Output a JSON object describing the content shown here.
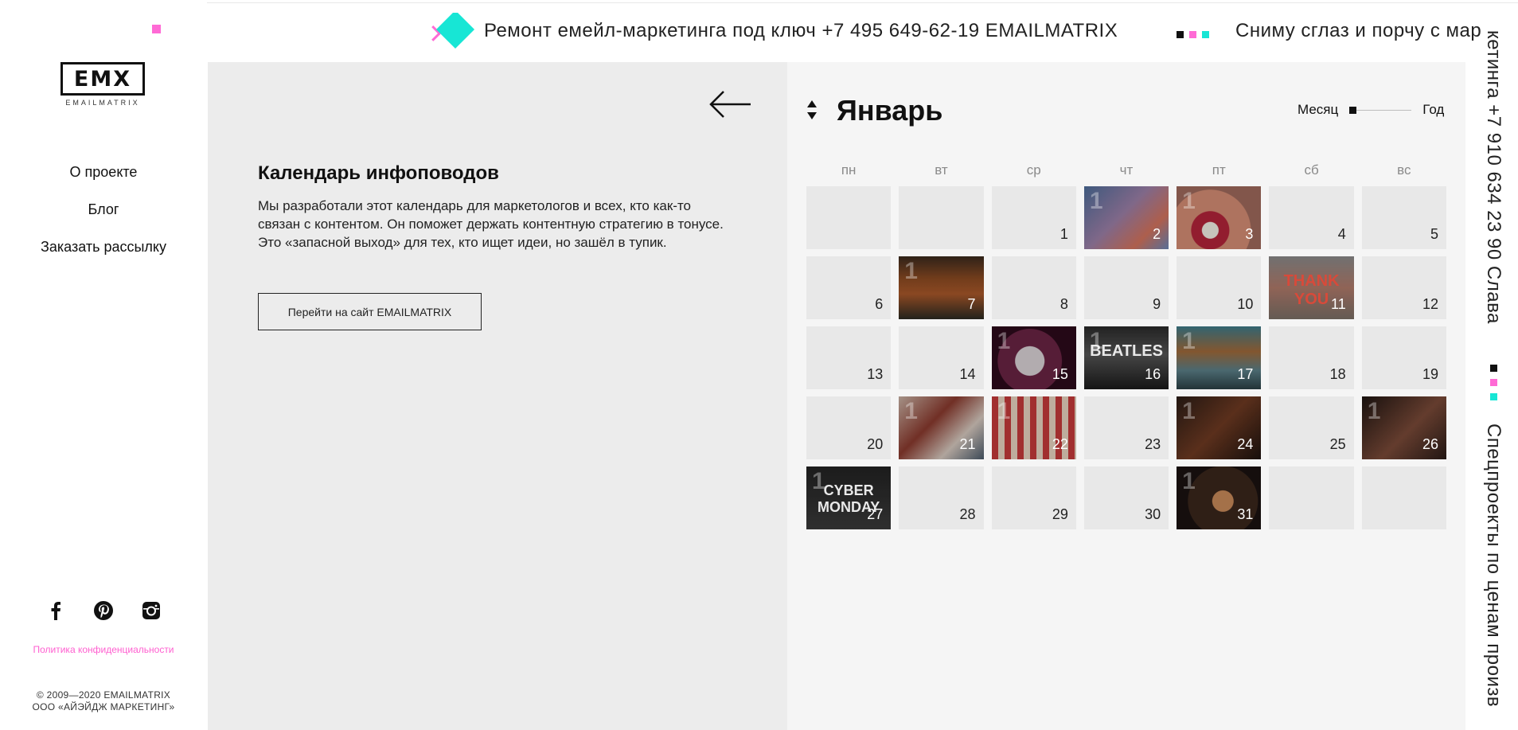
{
  "sidebar": {
    "logo_mark": "EMX",
    "logo_name": "EMAILMATRIX",
    "nav": [
      "О проекте",
      "Блог",
      "Заказать рассылку"
    ],
    "social": [
      "facebook-icon",
      "pinterest-icon",
      "instagram-icon"
    ],
    "policy": "Политика конфиденциальности",
    "copyright_line1": "© 2009—2020 EMAILMATRIX",
    "copyright_line2": "ООО «АЙЭЙДЖ МАРКЕТИНГ»"
  },
  "marquee": {
    "text1": "Ремонт емейл-маркетинга под ключ +7 495 649-62-19 EMAILMATRIX",
    "text2": "Сниму сглаз и порчу с мар",
    "vertical_text1": "кетинга +7 910 634 23 90 Слава",
    "vertical_text2": "Спецпроекты по ценам произв"
  },
  "intro": {
    "title": "Календарь инфоповодов",
    "description": "Мы разработали этот календарь для маркетологов и всех, кто как-то связан с контентом. Он поможет держать контентную стратегию в тонусе. Это «запасной выход» для тех, кто ищет идеи, но зашёл в тупик.",
    "button": "Перейти на сайт EMAILMATRIX"
  },
  "calendar": {
    "month": "Январь",
    "view_month": "Месяц",
    "view_year": "Год",
    "weekdays": [
      "пн",
      "вт",
      "ср",
      "чт",
      "пт",
      "сб",
      "вс"
    ],
    "days": [
      {
        "day": "",
        "img": false
      },
      {
        "day": "",
        "img": false
      },
      {
        "day": "1",
        "img": false
      },
      {
        "day": "2",
        "img": true,
        "badge": "1",
        "bg": "linear-gradient(135deg,#4d6d9a 0%,#9c7fa7 45%,#d4745e 75%,#6c87b8 100%)"
      },
      {
        "day": "3",
        "img": true,
        "badge": "1",
        "bg": "radial-gradient(circle at 40% 70%,#f2efe6 0 12%,#b2243a 13% 28%,#d58d74 29% 60%,#9f6a5c 61%)"
      },
      {
        "day": "4",
        "img": false
      },
      {
        "day": "5",
        "img": false
      },
      {
        "day": "6",
        "img": false
      },
      {
        "day": "7",
        "img": true,
        "badge": "1",
        "bg": "linear-gradient(180deg,#3a2a1e 0%,#8b4a22 35%,#a9582a 60%,#2a2a22 100%)"
      },
      {
        "day": "8",
        "img": false
      },
      {
        "day": "9",
        "img": false
      },
      {
        "day": "10",
        "img": false
      },
      {
        "day": "11",
        "img": true,
        "badge": "",
        "caption": "THANK YOU",
        "bg": "linear-gradient(180deg,#8a8a8a 0%,#b07a6a 50%,#7a6f66 100%)"
      },
      {
        "day": "12",
        "img": false
      },
      {
        "day": "13",
        "img": false
      },
      {
        "day": "14",
        "img": false
      },
      {
        "day": "15",
        "img": true,
        "badge": "1",
        "bg": "radial-gradient(circle at 45% 55%,#d9d2d6 0 25%,#6a2444 26% 55%,#2d0a1c 56%)"
      },
      {
        "day": "16",
        "img": true,
        "badge": "1",
        "caption": "BEATLES",
        "bg": "linear-gradient(180deg,#2a2a2a 0%,#555 45%,#1a1a1a 100%)"
      },
      {
        "day": "17",
        "img": true,
        "badge": "1",
        "bg": "linear-gradient(180deg,#3e7b8a 0%,#a06a3a 40%,#5b7f88 70%,#2b3f44 100%)"
      },
      {
        "day": "18",
        "img": false
      },
      {
        "day": "19",
        "img": false
      },
      {
        "day": "20",
        "img": false
      },
      {
        "day": "21",
        "img": true,
        "badge": "1",
        "bg": "linear-gradient(135deg,#c9b2a5 0%,#8a3a2e 40%,#d7c9bf 70%,#4a5a6a 100%)"
      },
      {
        "day": "22",
        "img": true,
        "badge": "1",
        "bg": "repeating-linear-gradient(90deg,#c53a3a 0 8px,#e8d3c0 8px 16px)"
      },
      {
        "day": "23",
        "img": false
      },
      {
        "day": "24",
        "img": true,
        "badge": "1",
        "bg": "linear-gradient(135deg,#2a1c16 0%,#6e3a22 50%,#1c120e 100%)"
      },
      {
        "day": "25",
        "img": false
      },
      {
        "day": "26",
        "img": true,
        "badge": "1",
        "bg": "linear-gradient(135deg,#1e1512 0%,#7a4a38 55%,#2a1c18 100%)"
      },
      {
        "day": "27",
        "img": true,
        "badge": "1",
        "caption": "CYBER MONDAY",
        "bg": "linear-gradient(180deg,#222 0%,#3a3a3a 100%)"
      },
      {
        "day": "28",
        "img": false
      },
      {
        "day": "29",
        "img": false
      },
      {
        "day": "30",
        "img": false
      },
      {
        "day": "31",
        "img": true,
        "badge": "1",
        "bg": "radial-gradient(circle at 55% 55%,#c98a5a 0 18%,#3a261c 19% 60%,#1a1210 61%)"
      },
      {
        "day": "",
        "img": false
      },
      {
        "day": "",
        "img": false
      }
    ]
  },
  "colors": {
    "accent_pink": "#ff6ad5",
    "accent_cyan": "#17e6d5",
    "panel_gray": "#ececec",
    "calendar_bg": "#f5f5f5",
    "cell_bg": "#e8e8e8"
  }
}
